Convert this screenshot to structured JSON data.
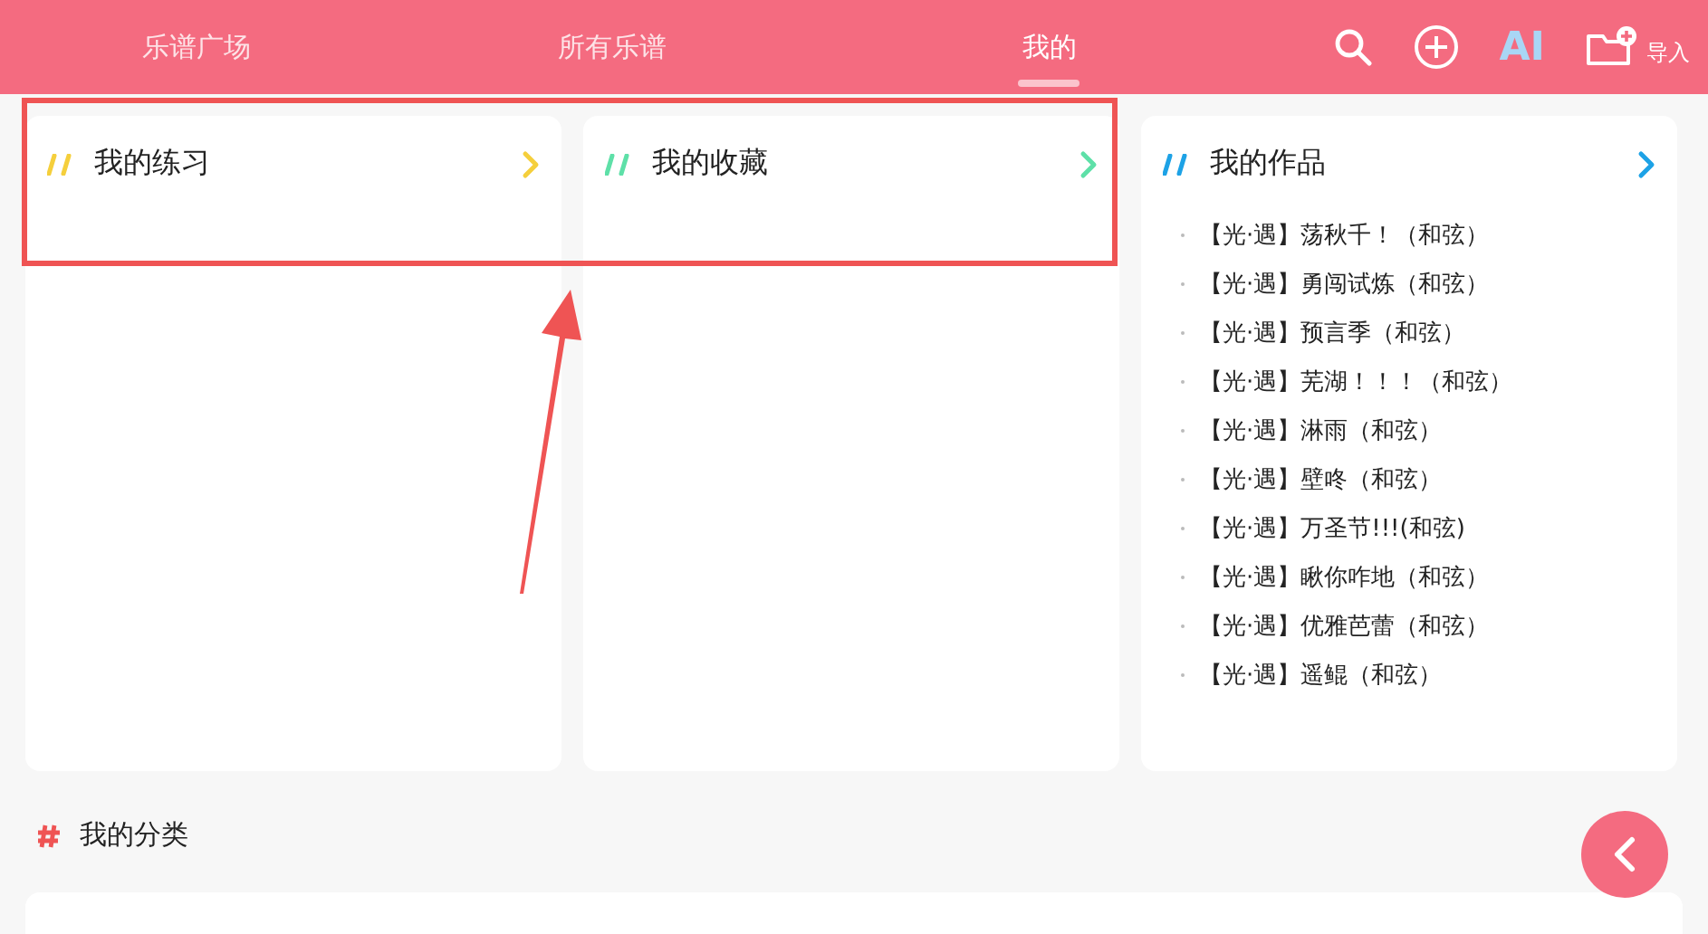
{
  "tabs": [
    {
      "label": "乐谱广场",
      "selected": false
    },
    {
      "label": "所有乐谱",
      "selected": false
    },
    {
      "label": "我的",
      "selected": true
    }
  ],
  "toolbar": {
    "ai_label": "AI",
    "import_label": "导入"
  },
  "cards": [
    {
      "title": "我的练习",
      "color": "#f5cf3c"
    },
    {
      "title": "我的收藏",
      "color": "#5ee0a8"
    },
    {
      "title": "我的作品",
      "color": "#1da2e6",
      "items": [
        "【光·遇】荡秋千！（和弦）",
        "【光·遇】勇闯试炼（和弦）",
        "【光·遇】预言季（和弦）",
        "【光·遇】芜湖！！！（和弦）",
        "【光·遇】淋雨（和弦）",
        "【光·遇】壁咚（和弦）",
        "【光·遇】万圣节!!!(和弦)",
        "【光·遇】瞅你咋地（和弦）",
        "【光·遇】优雅芭蕾（和弦）",
        "【光·遇】遥鲲（和弦）"
      ]
    }
  ],
  "section": {
    "title": "我的分类"
  }
}
